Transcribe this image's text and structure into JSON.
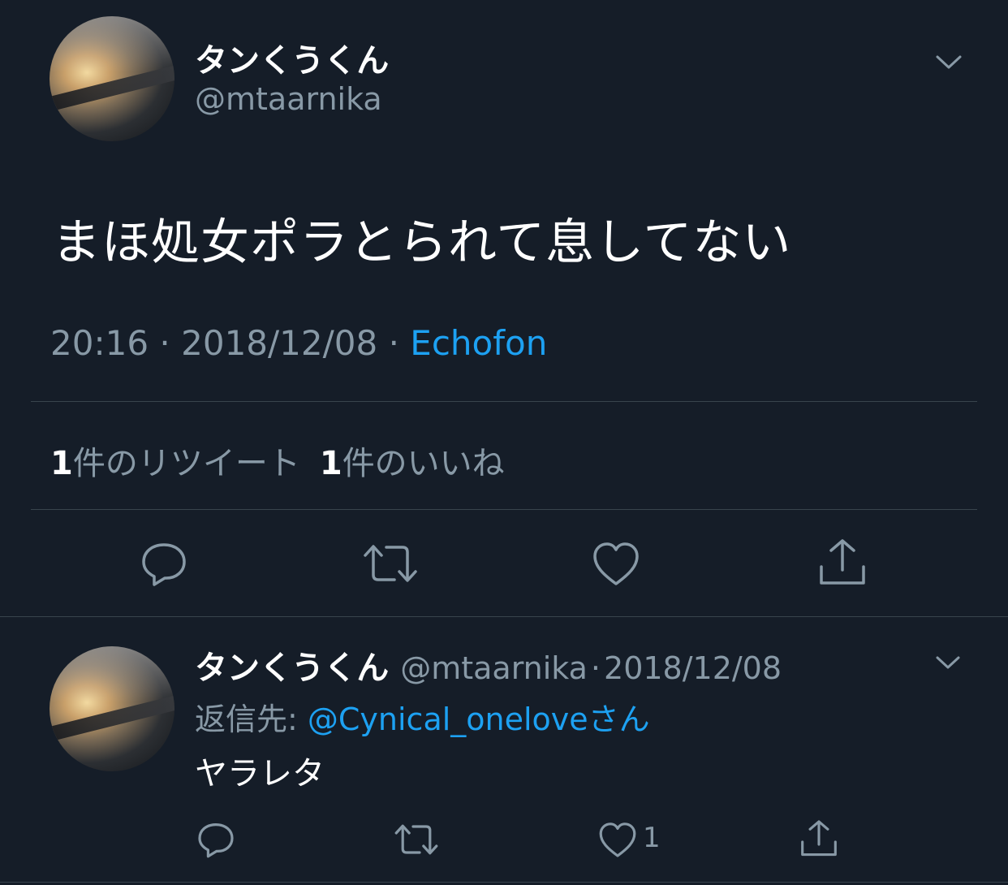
{
  "main_tweet": {
    "display_name": "タンくうくん",
    "handle": "@mtaarnika",
    "text": "まほ処女ポラとられて息してない",
    "time": "20:16",
    "dot1": "·",
    "date": "2018/12/08",
    "dot2": "·",
    "source": "Echofon",
    "retweet_count": "1",
    "retweet_label": "件のリツイート",
    "like_count": "1",
    "like_label": "件のいいね"
  },
  "reply_tweet": {
    "display_name": "タンくうくん",
    "handle": "@mtaarnika",
    "dot": "·",
    "date": "2018/12/08",
    "reply_to_label": "返信先: ",
    "reply_to_handle": "@Cynical_oneloveさん",
    "text": "ヤラレタ",
    "like_count": "1"
  },
  "icons": {
    "chevron": "chevron-down-icon",
    "reply": "reply-icon",
    "retweet": "retweet-icon",
    "like": "heart-icon",
    "share": "share-icon"
  },
  "colors": {
    "background": "#151d28",
    "text_primary": "#ffffff",
    "text_secondary": "#8899a6",
    "accent": "#1da1f2",
    "divider": "#38444d"
  }
}
